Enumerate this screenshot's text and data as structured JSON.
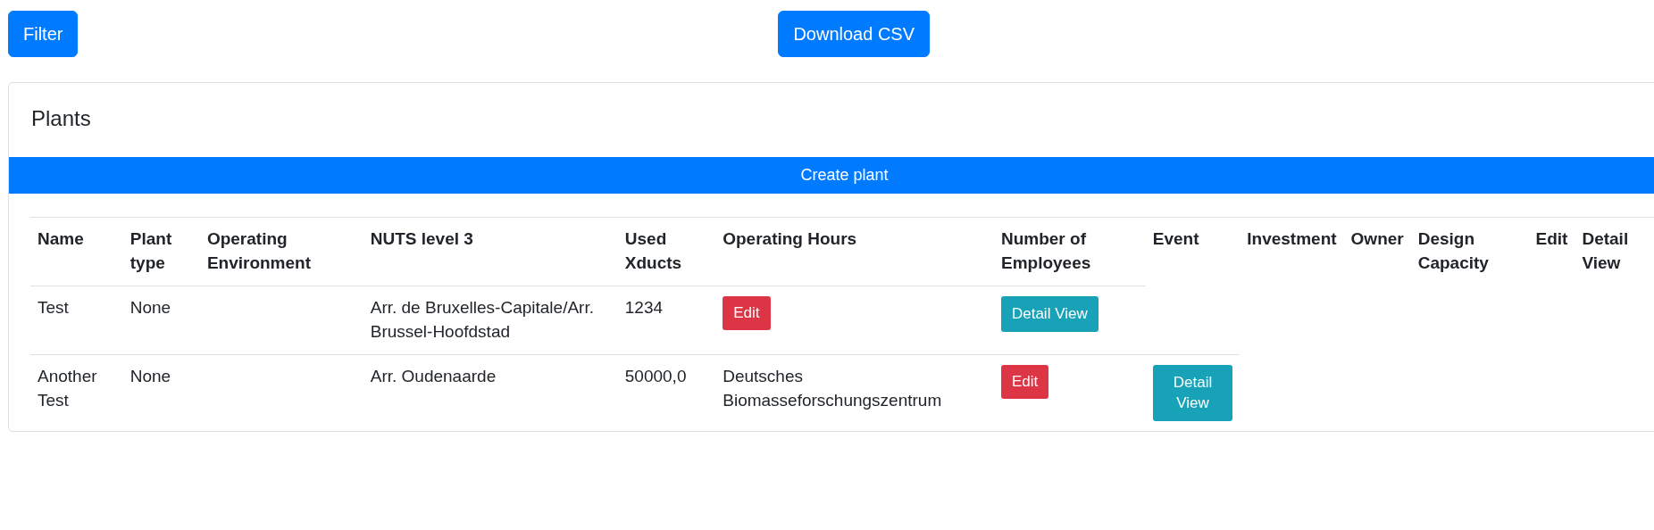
{
  "toolbar": {
    "filter_button": "Filter",
    "download_button": "Download CSV"
  },
  "card": {
    "title": "Plants",
    "create_button": "Create plant"
  },
  "table": {
    "columns": [
      "Name",
      "Plant type",
      "Operating Environment",
      "NUTS level 3",
      "Used Xducts",
      "Operating Hours",
      "Number of Employees",
      "Event",
      "Investment",
      "Owner",
      "Design Capacity",
      "Edit",
      "Detail View"
    ],
    "rows": [
      {
        "cells": [
          {
            "kind": "text",
            "text": "Test"
          },
          {
            "kind": "text",
            "text": "None"
          },
          {
            "kind": "text",
            "text": ""
          },
          {
            "kind": "text",
            "text": "Arr. de Bruxelles-Capitale/Arr. Brussel-Hoofdstad"
          },
          {
            "kind": "text",
            "text": "1234"
          },
          {
            "kind": "edit",
            "text": "Edit"
          },
          {
            "kind": "detail",
            "text": "Detail View"
          }
        ]
      },
      {
        "cells": [
          {
            "kind": "text",
            "text": "Another Test"
          },
          {
            "kind": "text",
            "text": "None"
          },
          {
            "kind": "text",
            "text": ""
          },
          {
            "kind": "text",
            "text": "Arr. Oudenaarde"
          },
          {
            "kind": "text",
            "text": "50000,0"
          },
          {
            "kind": "text",
            "text": "Deutsches Biomasseforschungszentrum"
          },
          {
            "kind": "edit",
            "text": "Edit"
          },
          {
            "kind": "detail",
            "text": "Detail View"
          }
        ]
      }
    ]
  }
}
